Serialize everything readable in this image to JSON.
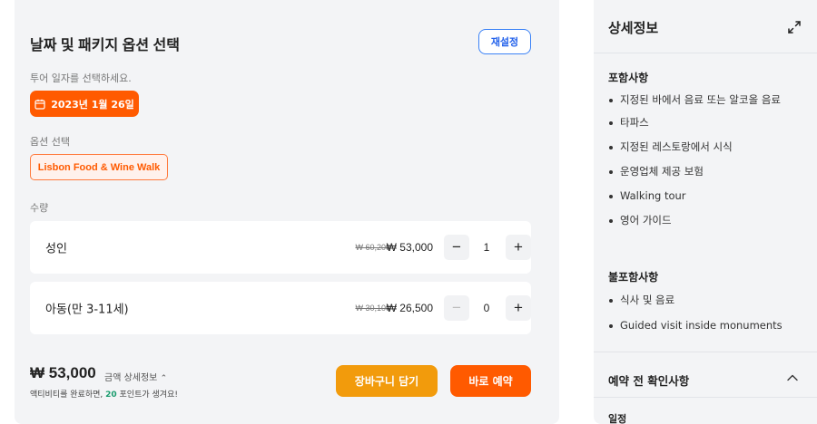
{
  "left": {
    "title": "날짜 및 패키지 옵션 선택",
    "reset_label": "재설정",
    "date_prompt": "투어 일자를 선택하세요.",
    "selected_date": "2023년 1월 26일",
    "option_label": "옵션 선택",
    "selected_option": "Lisbon Food & Wine Walk",
    "quantity_label": "수량",
    "rows": [
      {
        "name": "성인",
        "original_price": "₩ 60,200",
        "price": "₩ 53,000",
        "minus": "−",
        "quantity": "1",
        "plus": "+",
        "minus_disabled": false
      },
      {
        "name": "아동(만 3-11세)",
        "original_price": "₩ 30,100",
        "price": "₩ 26,500",
        "minus": "−",
        "quantity": "0",
        "plus": "+",
        "minus_disabled": true
      }
    ],
    "total_price": "₩ 53,000",
    "total_detail": "금액 상세정보",
    "points_prefix": "액티비티를 완료하면,",
    "points_value": "20",
    "points_suffix": "포인트가 생겨요!",
    "cart_label": "장바구니 담기",
    "book_label": "바로 예약"
  },
  "right": {
    "title": "상세정보",
    "included_head": "포함사항",
    "included": [
      "지정된 바에서 음료 또는 알코올 음료",
      "타파스",
      "지정된 레스토랑에서 시식",
      "운영업체 제공 보험",
      "Walking tour",
      "영어 가이드"
    ],
    "excluded_head": "불포함사항",
    "excluded": [
      "식사 및 음료",
      "Guided visit inside monuments"
    ],
    "precheck_head": "예약 전 확인사항",
    "schedule_head": "일정"
  },
  "icons": {
    "calendar": "calendar-icon",
    "expand": "expand-icon",
    "chevron_up": "chevron-up-icon"
  },
  "colors": {
    "accent_orange": "#ff5a00",
    "cart_amber": "#f29b0c",
    "reset_blue": "#2563eb",
    "points_green": "#1a9c6e"
  }
}
